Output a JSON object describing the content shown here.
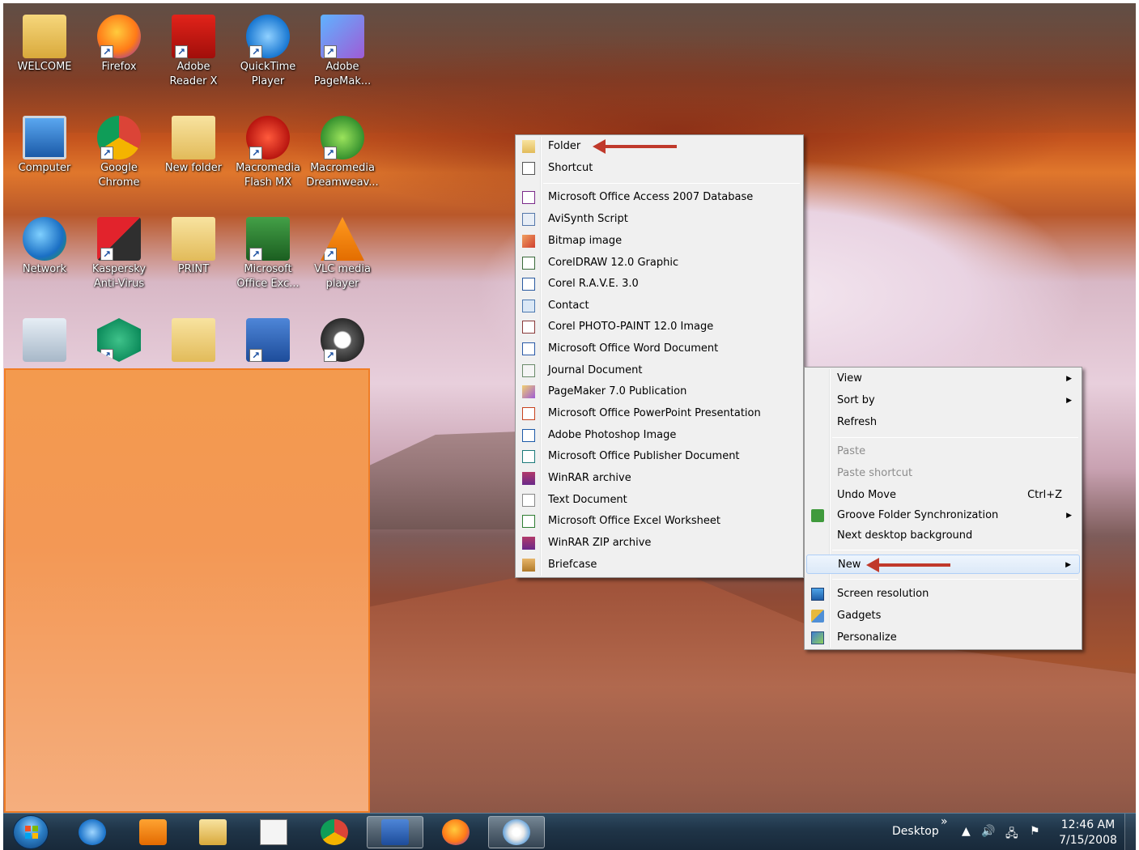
{
  "desktop": {
    "icons": [
      {
        "label": "WELCOME",
        "icon": "folder-user-icon"
      },
      {
        "label": "Firefox",
        "icon": "firefox-icon"
      },
      {
        "label": "Adobe\nReader X",
        "icon": "adobe-reader-icon"
      },
      {
        "label": "QuickTime\nPlayer",
        "icon": "quicktime-icon"
      },
      {
        "label": "Adobe\nPageMak...",
        "icon": "pagemaker-icon"
      },
      {
        "label": "Computer",
        "icon": "computer-icon"
      },
      {
        "label": "Google\nChrome",
        "icon": "chrome-icon"
      },
      {
        "label": "New folder",
        "icon": "folder-icon"
      },
      {
        "label": "Macromedia\nFlash MX",
        "icon": "flash-icon"
      },
      {
        "label": "Macromedia\nDreamweav...",
        "icon": "dreamweaver-icon"
      },
      {
        "label": "Network",
        "icon": "network-icon"
      },
      {
        "label": "Kaspersky\nAnti-Virus",
        "icon": "kaspersky-icon"
      },
      {
        "label": "PRINT",
        "icon": "folder-icon"
      },
      {
        "label": "Microsoft\nOffice Exc...",
        "icon": "excel-icon"
      },
      {
        "label": "VLC media\nplayer",
        "icon": "vlc-icon"
      },
      {
        "label": "",
        "icon": "recycle-bin-icon"
      },
      {
        "label": "",
        "icon": "kaspersky-secure-icon"
      },
      {
        "label": "",
        "icon": "folder-icon"
      },
      {
        "label": "",
        "icon": "word-icon"
      },
      {
        "label": "",
        "icon": "film-reel-icon"
      }
    ]
  },
  "new_submenu": {
    "items": [
      {
        "label": "Folder",
        "icon": "folder-icon"
      },
      {
        "label": "Shortcut",
        "icon": "shortcut-icon"
      },
      {
        "label": "Microsoft Office Access 2007 Database",
        "icon": "access-icon"
      },
      {
        "label": "AviSynth Script",
        "icon": "avisynth-icon"
      },
      {
        "label": "Bitmap image",
        "icon": "bitmap-icon"
      },
      {
        "label": "CorelDRAW 12.0 Graphic",
        "icon": "coreldraw-icon"
      },
      {
        "label": "Corel R.A.V.E. 3.0",
        "icon": "corel-rave-icon"
      },
      {
        "label": "Contact",
        "icon": "contact-icon"
      },
      {
        "label": "Corel PHOTO-PAINT 12.0 Image",
        "icon": "photopaint-icon"
      },
      {
        "label": "Microsoft Office Word Document",
        "icon": "word-doc-icon"
      },
      {
        "label": "Journal Document",
        "icon": "journal-icon"
      },
      {
        "label": "PageMaker 7.0 Publication",
        "icon": "pagemaker-doc-icon"
      },
      {
        "label": "Microsoft Office PowerPoint Presentation",
        "icon": "powerpoint-icon"
      },
      {
        "label": "Adobe Photoshop Image",
        "icon": "photoshop-icon"
      },
      {
        "label": "Microsoft Office Publisher Document",
        "icon": "publisher-icon"
      },
      {
        "label": "WinRAR archive",
        "icon": "winrar-icon"
      },
      {
        "label": "Text Document",
        "icon": "text-doc-icon"
      },
      {
        "label": "Microsoft Office Excel Worksheet",
        "icon": "excel-doc-icon"
      },
      {
        "label": "WinRAR ZIP archive",
        "icon": "winrar-zip-icon"
      },
      {
        "label": "Briefcase",
        "icon": "briefcase-icon"
      }
    ]
  },
  "desktop_menu": {
    "view": "View",
    "sort_by": "Sort by",
    "refresh": "Refresh",
    "paste": "Paste",
    "paste_shortcut": "Paste shortcut",
    "undo_move": "Undo Move",
    "undo_accel": "Ctrl+Z",
    "groove": "Groove Folder Synchronization",
    "next_bg": "Next desktop background",
    "new": "New",
    "screen_resolution": "Screen resolution",
    "gadgets": "Gadgets",
    "personalize": "Personalize"
  },
  "taskbar": {
    "pinned": [
      "internet-explorer-icon",
      "media-player-icon",
      "file-explorer-icon",
      "notepad-icon",
      "chrome-icon",
      "word-icon",
      "firefox-icon",
      "paint-icon"
    ],
    "desktop_label": "Desktop",
    "chevron": "»",
    "time": "12:46 AM",
    "date": "7/15/2008"
  },
  "colors": {
    "accent_arrow": "#c0392b",
    "overlay": "#f39855"
  }
}
